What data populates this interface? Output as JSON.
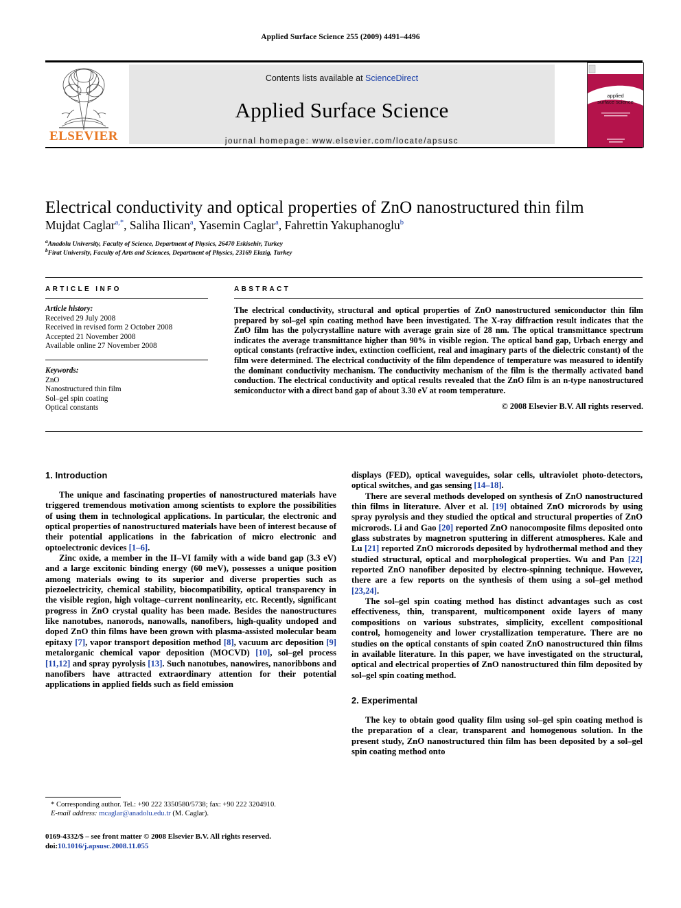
{
  "running_head": "Applied Surface Science 255 (2009) 4491–4496",
  "masthead": {
    "contents_prefix": "Contents lists available at ",
    "sciencedirect": "ScienceDirect",
    "journal_title": "Applied Surface Science",
    "homepage": "journal homepage: www.elsevier.com/locate/apsusc",
    "publisher": "ELSEVIER",
    "publisher_color": "#E87722",
    "cover_title_line1": "applied",
    "cover_title_line2": "surface science",
    "cover_color": "#B4134B"
  },
  "title": "Electrical conductivity and optical properties of ZnO nanostructured thin film",
  "authors": [
    {
      "name": "Mujdat Caglar",
      "marks": "a,*"
    },
    {
      "name": "Saliha Ilican",
      "marks": "a"
    },
    {
      "name": "Yasemin Caglar",
      "marks": "a"
    },
    {
      "name": "Fahrettin Yakuphanoglu",
      "marks": "b"
    }
  ],
  "affiliations": [
    {
      "mark": "a",
      "text": "Anadolu University, Faculty of Science, Department of Physics, 26470 Eskisehir, Turkey"
    },
    {
      "mark": "b",
      "text": "Firat University, Faculty of Arts and Sciences, Department of Physics, 23169 Elazig, Turkey"
    }
  ],
  "article_info": {
    "heading": "ARTICLE INFO",
    "history_label": "Article history:",
    "history": [
      "Received 29 July 2008",
      "Received in revised form 2 October 2008",
      "Accepted 21 November 2008",
      "Available online 27 November 2008"
    ],
    "keywords_label": "Keywords:",
    "keywords": [
      "ZnO",
      "Nanostructured thin film",
      "Sol–gel spin coating",
      "Optical constants"
    ]
  },
  "abstract": {
    "heading": "ABSTRACT",
    "text": "The electrical conductivity, structural and optical properties of ZnO nanostructured semiconductor thin film prepared by sol–gel spin coating method have been investigated. The X-ray diffraction result indicates that the ZnO film has the polycrystalline nature with average grain size of 28 nm. The optical transmittance spectrum indicates the average transmittance higher than 90% in visible region. The optical band gap, Urbach energy and optical constants (refractive index, extinction coefficient, real and imaginary parts of the dielectric constant) of the film were determined. The electrical conductivity of the film dependence of temperature was measured to identify the dominant conductivity mechanism. The conductivity mechanism of the film is the thermally activated band conduction. The electrical conductivity and optical results revealed that the ZnO film is an n-type nanostructured semiconductor with a direct band gap of about 3.30 eV at room temperature.",
    "copyright": "© 2008 Elsevier B.V. All rights reserved."
  },
  "sections": {
    "introduction_heading": "1. Introduction",
    "experimental_heading": "2. Experimental"
  },
  "body": {
    "left": [
      "The unique and fascinating properties of nanostructured materials have triggered tremendous motivation among scientists to explore the possibilities of using them in technological applications. In particular, the electronic and optical properties of nanostructured materials have been of interest because of their potential applications in the fabrication of micro electronic and optoelectronic devices [1–6].",
      "Zinc oxide, a member in the II–VI family with a wide band gap (3.3 eV) and a large excitonic binding energy (60 meV), possesses a unique position among materials owing to its superior and diverse properties such as piezoelectricity, chemical stability, biocompatibility, optical transparency in the visible region, high voltage–current nonlinearity, etc. Recently, significant progress in ZnO crystal quality has been made. Besides the nanostructures like nanotubes, nanorods, nanowalls, nanofibers, high-quality undoped and doped ZnO thin films have been grown with plasma-assisted molecular beam epitaxy [7], vapor transport deposition method [8], vacuum arc deposition [9] metalorganic chemical vapor deposition (MOCVD) [10], sol–gel process [11,12] and spray pyrolysis [13]. Such nanotubes, nanowires, nanoribbons and nanofibers have attracted extraordinary attention for their potential applications in applied fields such as field emission"
    ],
    "right": [
      "displays (FED), optical waveguides, solar cells, ultraviolet photo-detectors, optical switches, and gas sensing [14–18].",
      "There are several methods developed on synthesis of ZnO nanostructured thin films in literature. Alver et al. [19] obtained ZnO microrods by using spray pyrolysis and they studied the optical and structural properties of ZnO microrods. Li and Gao [20] reported ZnO nanocomposite films deposited onto glass substrates by magnetron sputtering in different atmospheres. Kale and Lu [21] reported ZnO microrods deposited by hydrothermal method and they studied structural, optical and morphological properties. Wu and Pan [22] reported ZnO nanofiber deposited by electro-spinning technique. However, there are a few reports on the synthesis of them using a sol–gel method [23,24].",
      "The sol–gel spin coating method has distinct advantages such as cost effectiveness, thin, transparent, multicomponent oxide layers of many compositions on various substrates, simplicity, excellent compositional control, homogeneity and lower crystallization temperature. There are no studies on the optical constants of spin coated ZnO nanostructured thin films in available literature. In this paper, we have investigated on the structural, optical and electrical properties of ZnO nanostructured thin film deposited by sol–gel spin coating method.",
      "The key to obtain good quality film using sol–gel spin coating method is the preparation of a clear, transparent and homogenous solution. In the present study, ZnO nanostructured thin film has been deposited by a sol–gel spin coating method onto"
    ]
  },
  "footnote": {
    "corresponding": "* Corresponding author. Tel.: +90 222 3350580/5738; fax: +90 222 3204910.",
    "email_label": "E-mail address:",
    "email": "mcaglar@anadolu.edu.tr",
    "email_suffix": " (M. Caglar)."
  },
  "imprint": {
    "line1": "0169-4332/$ – see front matter © 2008 Elsevier B.V. All rights reserved.",
    "doi_label": "doi:",
    "doi": "10.1016/j.apsusc.2008.11.055"
  }
}
